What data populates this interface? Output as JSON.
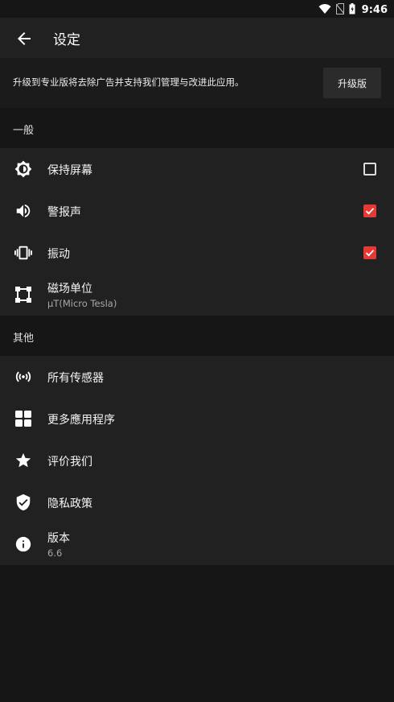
{
  "status_bar": {
    "time": "9:46"
  },
  "app_bar": {
    "title": "设定"
  },
  "upgrade": {
    "text": "升级到专业版将去除广告并支持我们管理与改进此应用。",
    "button_label": "升级版"
  },
  "general": {
    "header": "一般",
    "items": [
      {
        "label": "保持屏幕",
        "icon": "brightness-icon",
        "checked": false
      },
      {
        "label": "警报声",
        "icon": "volume-icon",
        "checked": true
      },
      {
        "label": "振动",
        "icon": "vibrate-icon",
        "checked": true
      },
      {
        "label": "磁场单位",
        "sub": "μT(Micro Tesla)",
        "icon": "unit-icon"
      }
    ]
  },
  "other": {
    "header": "其他",
    "items": [
      {
        "label": "所有传感器",
        "icon": "sensor-icon"
      },
      {
        "label": "更多應用程序",
        "icon": "apps-grid-icon"
      },
      {
        "label": "评价我们",
        "icon": "star-icon"
      },
      {
        "label": "隐私政策",
        "icon": "shield-icon"
      },
      {
        "label": "版本",
        "sub": "6.6",
        "icon": "info-icon"
      }
    ]
  },
  "colors": {
    "accent": "#e53935",
    "background": "#161616",
    "surface": "#212121"
  }
}
